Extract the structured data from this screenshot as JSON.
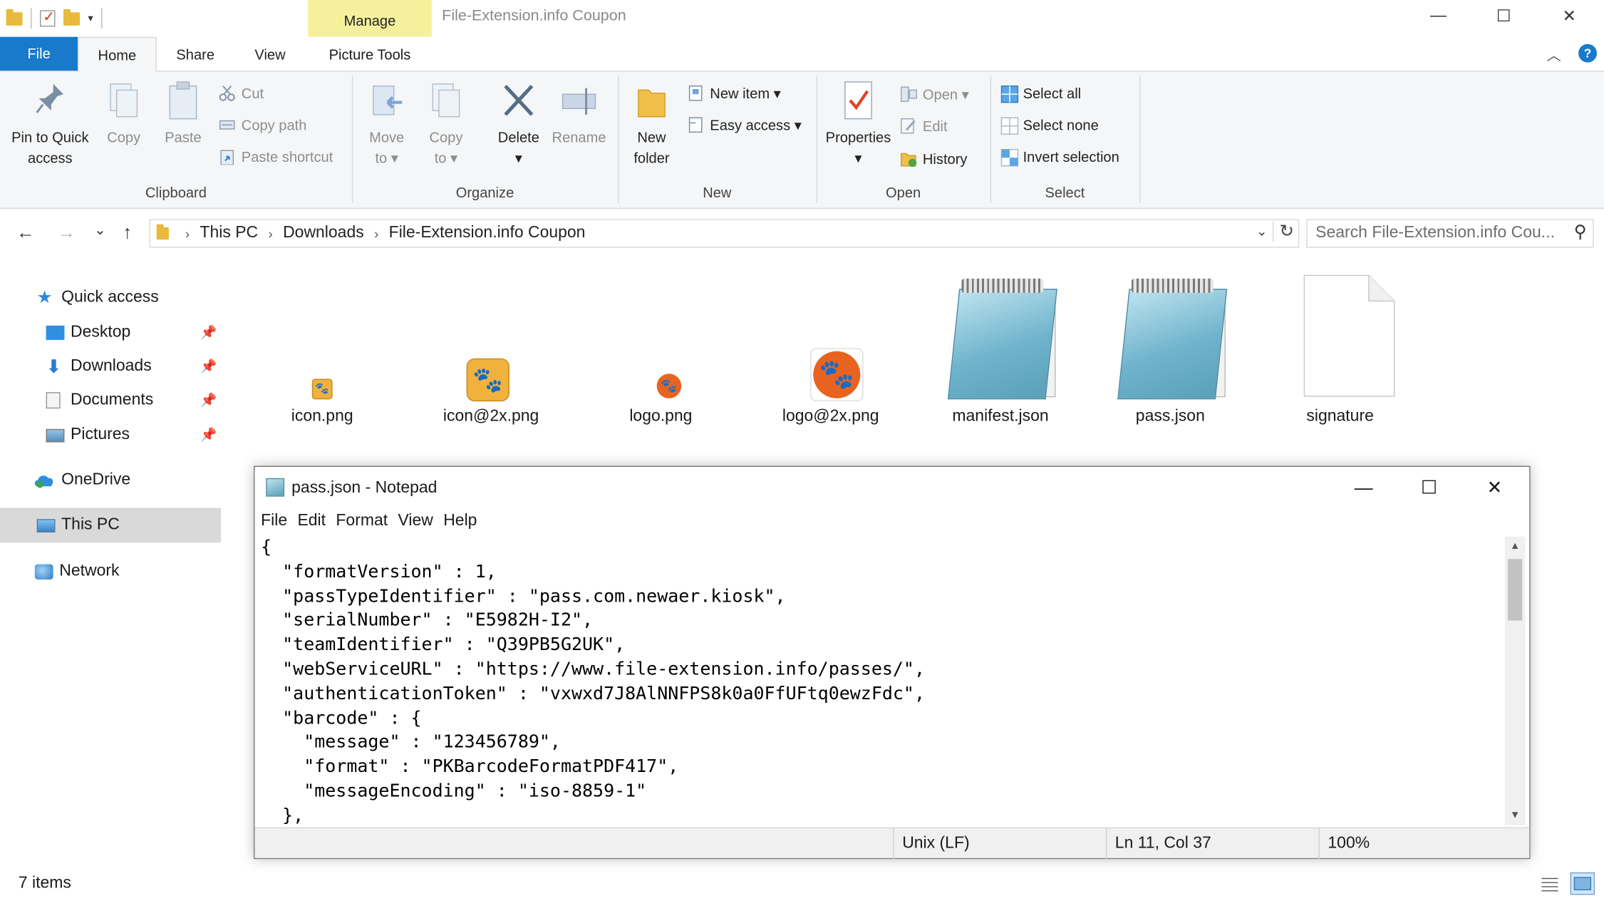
{
  "window": {
    "title": "File-Extension.info Coupon",
    "minimize_glyph": "—",
    "maximize_glyph": "☐",
    "close_glyph": "✕"
  },
  "qat": {
    "dropdown_glyph": "▾"
  },
  "context_tab": {
    "header": "Manage",
    "tab": "Picture Tools"
  },
  "tabs": {
    "file": "File",
    "home": "Home",
    "share": "Share",
    "view": "View"
  },
  "ribbon": {
    "collapse_glyph": "︿",
    "help_glyph": "?",
    "clipboard": {
      "label": "Clipboard",
      "pin": [
        "Pin to Quick",
        "access"
      ],
      "copy": "Copy",
      "paste": "Paste",
      "cut": "Cut",
      "copy_path": "Copy path",
      "paste_shortcut": "Paste shortcut"
    },
    "organize": {
      "label": "Organize",
      "move_to": [
        "Move",
        "to ▾"
      ],
      "copy_to": [
        "Copy",
        "to ▾"
      ],
      "delete": [
        "Delete",
        "▾"
      ],
      "rename": "Rename"
    },
    "new": {
      "label": "New",
      "new_folder": [
        "New",
        "folder"
      ],
      "new_item": "New item ▾",
      "easy_access": "Easy access ▾"
    },
    "open": {
      "label": "Open",
      "properties": [
        "Properties",
        "▾"
      ],
      "open": "Open ▾",
      "edit": "Edit",
      "history": "History"
    },
    "select": {
      "label": "Select",
      "select_all": "Select all",
      "select_none": "Select none",
      "invert_selection": "Invert selection"
    }
  },
  "navigation": {
    "back_glyph": "←",
    "forward_glyph": "→",
    "recent_glyph": "⌄",
    "up_glyph": "↑",
    "breadcrumb": [
      "This PC",
      "Downloads",
      "File-Extension.info Coupon"
    ],
    "crumb_sep": "›",
    "address_dropdown": "⌄",
    "refresh_glyph": "↻",
    "search_placeholder": "Search File-Extension.info Cou...",
    "search_glyph": "⚲"
  },
  "nav_pane": {
    "quick_access": "Quick access",
    "desktop": "Desktop",
    "downloads": "Downloads",
    "documents": "Documents",
    "pictures": "Pictures",
    "onedrive": "OneDrive",
    "this_pc": "This PC",
    "network": "Network",
    "pin_glyph": "📌"
  },
  "files": [
    {
      "name": "icon.png",
      "icon": "paw-small-icon"
    },
    {
      "name": "icon@2x.png",
      "icon": "paw-medium-icon"
    },
    {
      "name": "logo.png",
      "icon": "paw-circle-small-icon"
    },
    {
      "name": "logo@2x.png",
      "icon": "paw-circle-large-icon"
    },
    {
      "name": "manifest.json",
      "icon": "notepad-file-icon"
    },
    {
      "name": "pass.json",
      "icon": "notepad-file-icon"
    },
    {
      "name": "signature",
      "icon": "blank-file-icon"
    }
  ],
  "notepad": {
    "title": "pass.json - Notepad",
    "menu": [
      "File",
      "Edit",
      "Format",
      "View",
      "Help"
    ],
    "content": "{\n  \"formatVersion\" : 1,\n  \"passTypeIdentifier\" : \"pass.com.newaer.kiosk\",\n  \"serialNumber\" : \"E5982H-I2\",\n  \"teamIdentifier\" : \"Q39PB5G2UK\",\n  \"webServiceURL\" : \"https://www.file-extension.info/passes/\",\n  \"authenticationToken\" : \"vxwxd7J8AlNNFPS8k0a0FfUFtq0ewzFdc\",\n  \"barcode\" : {\n    \"message\" : \"123456789\",\n    \"format\" : \"PKBarcodeFormatPDF417\",\n    \"messageEncoding\" : \"iso-8859-1\"\n  },",
    "status_eol": "Unix (LF)",
    "status_pos": "Ln 11, Col 37",
    "status_zoom": "100%",
    "minimize_glyph": "—",
    "maximize_glyph": "☐",
    "close_glyph": "✕",
    "scroll_up": "▲",
    "scroll_down": "▼"
  },
  "statusbar": {
    "items": "7 items"
  }
}
